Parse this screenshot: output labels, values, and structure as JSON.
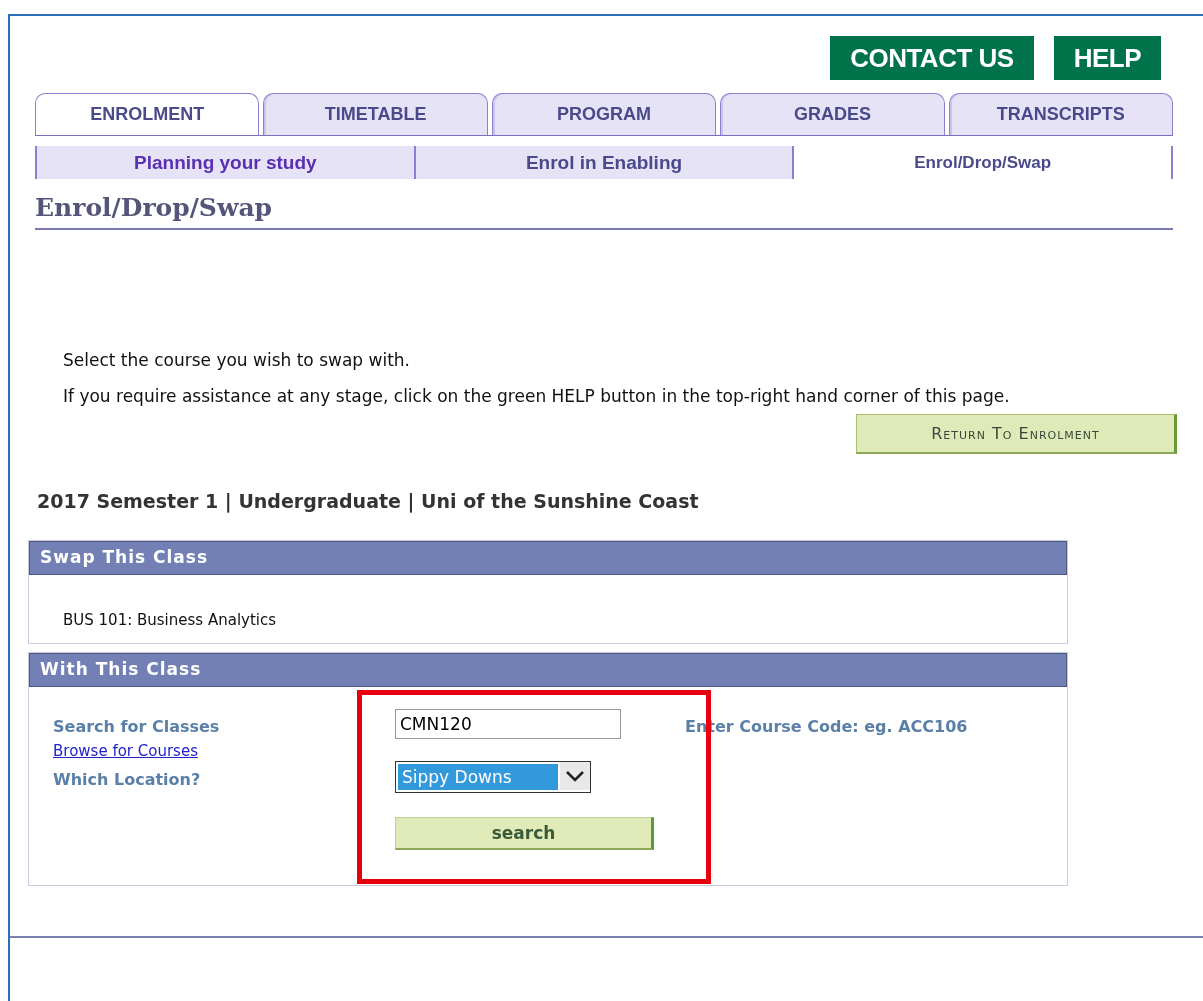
{
  "header_buttons": [
    "CONTACT US",
    "HELP"
  ],
  "tabs": [
    {
      "label": "ENROLMENT",
      "selected": true
    },
    {
      "label": "TIMETABLE",
      "selected": false
    },
    {
      "label": "PROGRAM",
      "selected": false
    },
    {
      "label": "GRADES",
      "selected": false
    },
    {
      "label": "TRANSCRIPTS",
      "selected": false
    }
  ],
  "subtabs": [
    {
      "label": "Planning your study",
      "selected": false
    },
    {
      "label": "Enrol in Enabling",
      "selected": false
    },
    {
      "label": "Enrol/Drop/Swap",
      "selected": true
    }
  ],
  "page_title": "Enrol/Drop/Swap",
  "instructions": [
    "Select the course you wish to swap with.",
    "If you require assistance at any stage, click on the green HELP button in the top-right hand corner of this page."
  ],
  "return_button": "Return To Enrolment",
  "term_line": "2017 Semester 1 | Undergraduate | Uni of the Sunshine Coast",
  "swap_section": {
    "title": "Swap This Class",
    "class": "BUS 101: Business Analytics"
  },
  "with_section": {
    "title": "With This Class",
    "search_label": "Search for Classes",
    "browse_link": "Browse for Courses",
    "location_label": "Which Location?",
    "course_code": "CMN120",
    "hint": "Enter Course Code: eg. ACC106",
    "location": "Sippy Downs",
    "search_button": "search",
    "highlight": true
  }
}
